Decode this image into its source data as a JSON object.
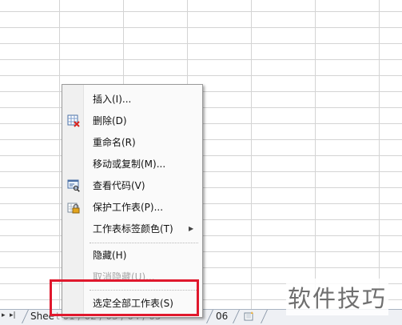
{
  "tabbar": {
    "nav_prev": "▸",
    "nav_last": "▸|",
    "first_tab": "Shee",
    "obscured_tab": "t 01 / 02 / 03 / 04 / 05",
    "last_tab": "06"
  },
  "menu": {
    "items": [
      {
        "label": "插入(I)..."
      },
      {
        "label": "删除(D)"
      },
      {
        "label": "重命名(R)"
      },
      {
        "label": "移动或复制(M)..."
      },
      {
        "label": "查看代码(V)"
      },
      {
        "label": "保护工作表(P)..."
      },
      {
        "label": "工作表标签颜色(T)"
      },
      {
        "label": "隐藏(H)"
      },
      {
        "label": "取消隐藏(U)..."
      },
      {
        "label": "选定全部工作表(S)"
      }
    ]
  },
  "watermark": "软件技巧",
  "colors": {
    "highlight": "#e0182d",
    "grid_line": "#d4d4d4",
    "menu_bg": "#fafafa"
  }
}
